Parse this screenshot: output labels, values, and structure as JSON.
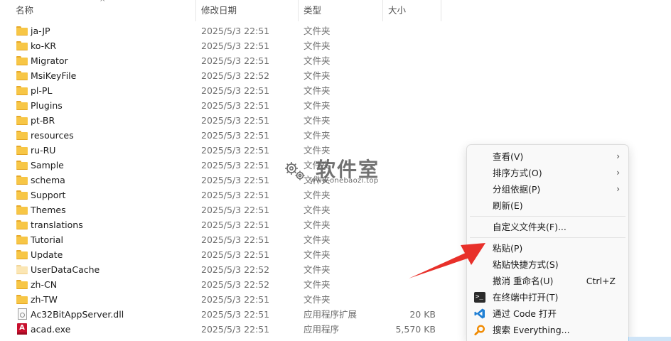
{
  "header": {
    "col_name": "名称",
    "col_date": "修改日期",
    "col_type": "类型",
    "col_size": "大小",
    "sort_indicator": "^"
  },
  "rows": [
    {
      "name": "ja-JP",
      "date": "2025/5/3 22:51",
      "type": "文件夹",
      "size": "",
      "icon": "folder-icon"
    },
    {
      "name": "ko-KR",
      "date": "2025/5/3 22:51",
      "type": "文件夹",
      "size": "",
      "icon": "folder-icon"
    },
    {
      "name": "Migrator",
      "date": "2025/5/3 22:51",
      "type": "文件夹",
      "size": "",
      "icon": "folder-icon"
    },
    {
      "name": "MsiKeyFile",
      "date": "2025/5/3 22:52",
      "type": "文件夹",
      "size": "",
      "icon": "folder-icon"
    },
    {
      "name": "pl-PL",
      "date": "2025/5/3 22:51",
      "type": "文件夹",
      "size": "",
      "icon": "folder-icon"
    },
    {
      "name": "Plugins",
      "date": "2025/5/3 22:51",
      "type": "文件夹",
      "size": "",
      "icon": "folder-icon"
    },
    {
      "name": "pt-BR",
      "date": "2025/5/3 22:51",
      "type": "文件夹",
      "size": "",
      "icon": "folder-icon"
    },
    {
      "name": "resources",
      "date": "2025/5/3 22:51",
      "type": "文件夹",
      "size": "",
      "icon": "folder-icon"
    },
    {
      "name": "ru-RU",
      "date": "2025/5/3 22:51",
      "type": "文件夹",
      "size": "",
      "icon": "folder-icon"
    },
    {
      "name": "Sample",
      "date": "2025/5/3 22:51",
      "type": "文件夹",
      "size": "",
      "icon": "folder-icon"
    },
    {
      "name": "schema",
      "date": "2025/5/3 22:51",
      "type": "文件夹",
      "size": "",
      "icon": "folder-icon"
    },
    {
      "name": "Support",
      "date": "2025/5/3 22:51",
      "type": "文件夹",
      "size": "",
      "icon": "folder-icon"
    },
    {
      "name": "Themes",
      "date": "2025/5/3 22:51",
      "type": "文件夹",
      "size": "",
      "icon": "folder-icon"
    },
    {
      "name": "translations",
      "date": "2025/5/3 22:51",
      "type": "文件夹",
      "size": "",
      "icon": "folder-icon"
    },
    {
      "name": "Tutorial",
      "date": "2025/5/3 22:51",
      "type": "文件夹",
      "size": "",
      "icon": "folder-icon"
    },
    {
      "name": "Update",
      "date": "2025/5/3 22:51",
      "type": "文件夹",
      "size": "",
      "icon": "folder-icon"
    },
    {
      "name": "UserDataCache",
      "date": "2025/5/3 22:52",
      "type": "文件夹",
      "size": "",
      "icon": "folder-light-icon"
    },
    {
      "name": "zh-CN",
      "date": "2025/5/3 22:52",
      "type": "文件夹",
      "size": "",
      "icon": "folder-icon"
    },
    {
      "name": "zh-TW",
      "date": "2025/5/3 22:51",
      "type": "文件夹",
      "size": "",
      "icon": "folder-icon"
    },
    {
      "name": "Ac32BitAppServer.dll",
      "date": "2025/5/3 22:51",
      "type": "应用程序扩展",
      "size": "20 KB",
      "icon": "dll-file-icon"
    },
    {
      "name": "acad.exe",
      "date": "2025/5/3 22:51",
      "type": "应用程序",
      "size": "5,570 KB",
      "icon": "autocad-app-icon"
    }
  ],
  "watermark": {
    "title": "软件室",
    "url": "www.onebaozi.top"
  },
  "context_menu": {
    "view": "查看(V)",
    "sort_by": "排序方式(O)",
    "group_by": "分组依据(P)",
    "refresh": "刷新(E)",
    "customize_folder": "自定义文件夹(F)...",
    "paste": "粘贴(P)",
    "paste_shortcut": "粘贴快捷方式(S)",
    "undo_rename": "撤消 重命名(U)",
    "undo_rename_shortcut": "Ctrl+Z",
    "open_in_terminal": "在终端中打开(T)",
    "open_with_code": "通过 Code 打开",
    "search_everything": "搜索 Everything..."
  },
  "colors": {
    "folder": "#f7c646",
    "annotation_arrow": "#e8302a",
    "vscode_blue": "#1f7fd4",
    "everything_orange": "#f08a00"
  }
}
